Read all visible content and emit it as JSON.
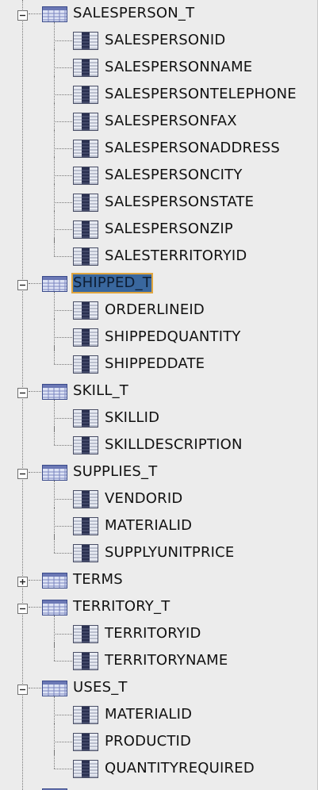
{
  "tree": [
    {
      "type": "table",
      "label": "SALESPERSON_T",
      "expanded": true,
      "selected": false
    },
    {
      "type": "column",
      "label": "SALESPERSONID"
    },
    {
      "type": "column",
      "label": "SALESPERSONNAME"
    },
    {
      "type": "column",
      "label": "SALESPERSONTELEPHONE"
    },
    {
      "type": "column",
      "label": "SALESPERSONFAX"
    },
    {
      "type": "column",
      "label": "SALESPERSONADDRESS"
    },
    {
      "type": "column",
      "label": "SALESPERSONCITY"
    },
    {
      "type": "column",
      "label": "SALESPERSONSTATE"
    },
    {
      "type": "column",
      "label": "SALESPERSONZIP"
    },
    {
      "type": "column",
      "label": "SALESTERRITORYID"
    },
    {
      "type": "table",
      "label": "SHIPPED_T",
      "expanded": true,
      "selected": true
    },
    {
      "type": "column",
      "label": "ORDERLINEID"
    },
    {
      "type": "column",
      "label": "SHIPPEDQUANTITY"
    },
    {
      "type": "column",
      "label": "SHIPPEDDATE"
    },
    {
      "type": "table",
      "label": "SKILL_T",
      "expanded": true,
      "selected": false
    },
    {
      "type": "column",
      "label": "SKILLID"
    },
    {
      "type": "column",
      "label": "SKILLDESCRIPTION"
    },
    {
      "type": "table",
      "label": "SUPPLIES_T",
      "expanded": true,
      "selected": false
    },
    {
      "type": "column",
      "label": "VENDORID"
    },
    {
      "type": "column",
      "label": "MATERIALID"
    },
    {
      "type": "column",
      "label": "SUPPLYUNITPRICE"
    },
    {
      "type": "table",
      "label": "TERMS",
      "expanded": false,
      "selected": false
    },
    {
      "type": "table",
      "label": "TERRITORY_T",
      "expanded": true,
      "selected": false
    },
    {
      "type": "column",
      "label": "TERRITORYID"
    },
    {
      "type": "column",
      "label": "TERRITORYNAME"
    },
    {
      "type": "table",
      "label": "USES_T",
      "expanded": true,
      "selected": false
    },
    {
      "type": "column",
      "label": "MATERIALID"
    },
    {
      "type": "column",
      "label": "PRODUCTID"
    },
    {
      "type": "column",
      "label": "QUANTITYREQUIRED"
    }
  ],
  "colors": {
    "background": "#ececec",
    "selection_fill": "#39679e",
    "selection_border": "#e0a640",
    "table_icon_border": "#3a4a8a",
    "table_icon_fill": "#dde3f5",
    "column_icon_dark": "#2a3050"
  }
}
